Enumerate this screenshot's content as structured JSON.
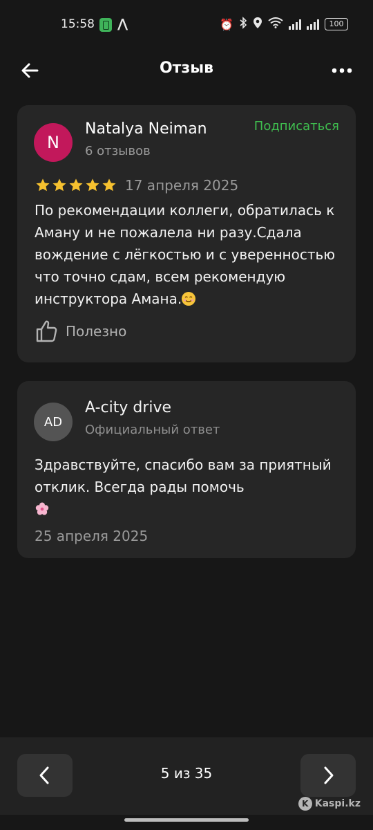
{
  "status_bar": {
    "time": "15:58",
    "battery": "100"
  },
  "header": {
    "title": "Отзыв",
    "back_icon": "arrow-left-icon",
    "more_icon": "more-horizontal-icon"
  },
  "review": {
    "avatar_letter": "N",
    "avatar_color": "#c2185b",
    "author": "Natalya Neiman",
    "reviews_count": "6 отзывов",
    "subscribe_label": "Подписаться",
    "subscribe_color": "#3fbf4f",
    "rating": 5,
    "date": "17 апреля 2025",
    "text": "По рекомендации коллеги, обратилась к Аману и не пожалела ни разу.Сдала вождение с лёгкостью и с уверенностью что точно сдам, всем рекомендую инструктора Амана.",
    "helpful_label": "Полезно"
  },
  "reply": {
    "avatar_initials": "AD",
    "author": "A-city drive",
    "subtitle": "Официальный ответ",
    "text": "Здравствуйте, спасибо вам за приятный отклик. Всегда рады помочь",
    "date": "25 апреля 2025"
  },
  "pagination": {
    "indicator": "5 из 35",
    "prev_icon": "chevron-left-icon",
    "next_icon": "chevron-right-icon"
  },
  "watermark": {
    "text": "Kaspi.kz"
  }
}
